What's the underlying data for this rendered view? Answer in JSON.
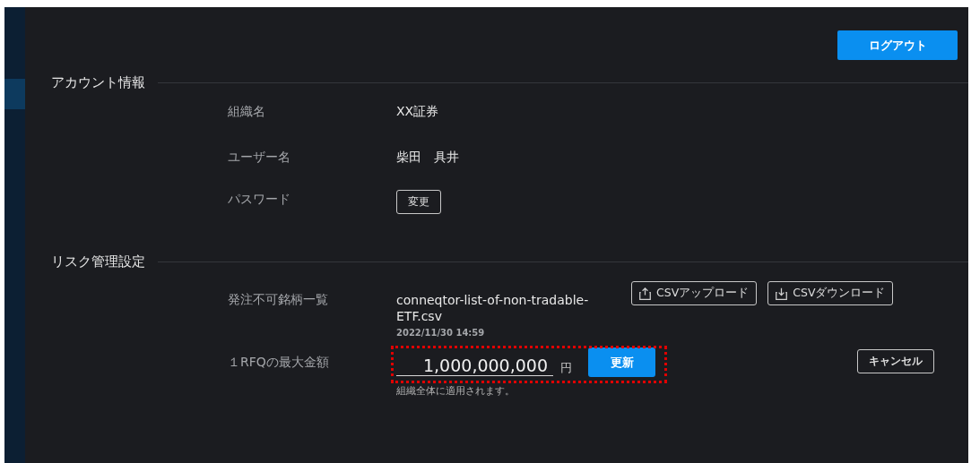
{
  "header": {
    "logout_button": "ログアウト"
  },
  "sections": [
    {
      "title": "アカウント情報",
      "rows": [
        {
          "kind": "text",
          "label": "組織名",
          "value": "XX証券"
        },
        {
          "kind": "text",
          "label": "ユーザー名",
          "value": "柴田　具井"
        },
        {
          "kind": "button",
          "label": "パスワード",
          "button": "変更"
        }
      ]
    },
    {
      "title": "リスク管理設定",
      "rows": [
        {
          "kind": "file",
          "label": "発注不可銘柄一覧",
          "file_name": "conneqtor-list-of-non-tradable-ETF.csv",
          "timestamp": "2022/11/30 14:59",
          "upload_button": "CSVアップロード",
          "download_button": "CSVダウンロード"
        },
        {
          "kind": "amount",
          "label": "１RFQの最大金額",
          "value": "1,000,000,000",
          "unit": "円",
          "update_button": "更新",
          "hint": "組織全体に適用されます。",
          "cancel_button": "キャンセル",
          "highlighted": true
        }
      ]
    }
  ]
}
